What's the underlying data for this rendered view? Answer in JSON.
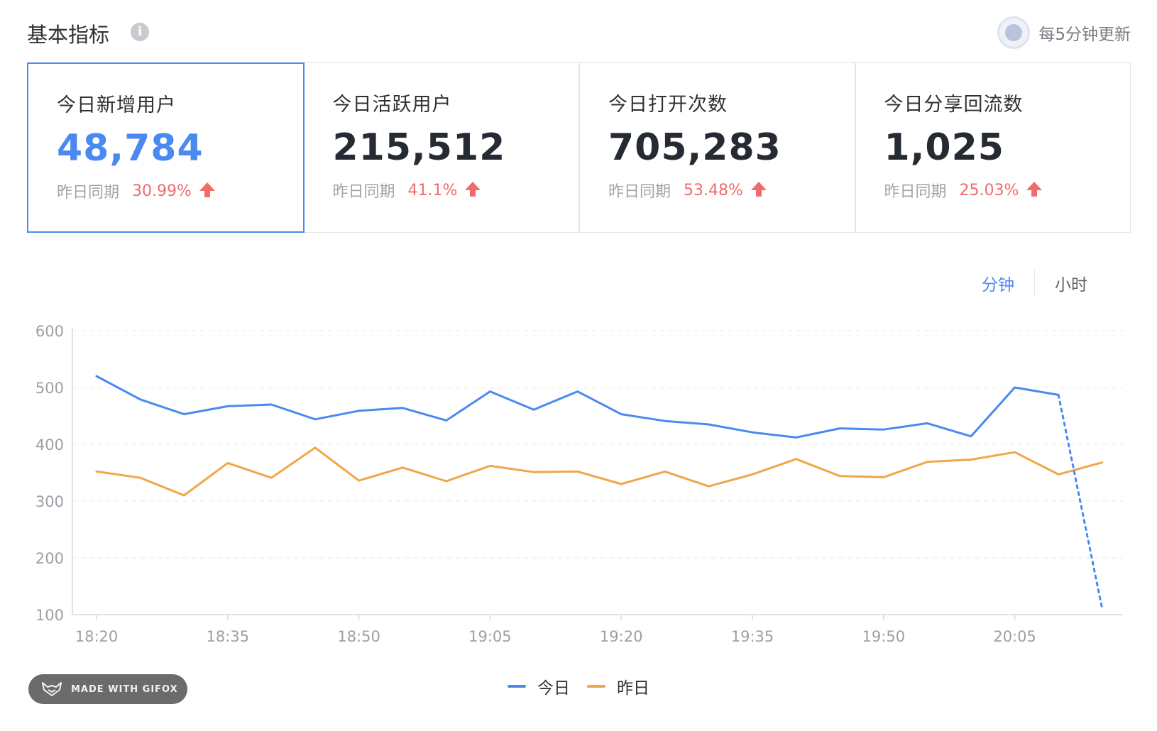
{
  "header": {
    "title": "基本指标",
    "info_icon": "info-icon",
    "refresh_text": "每5分钟更新",
    "refresh_icon": "refresh-globe-icon"
  },
  "cards": [
    {
      "title": "今日新增用户",
      "value": "48,784",
      "compare_label": "昨日同期",
      "compare_pct": "30.99%",
      "trend": "up",
      "active": true
    },
    {
      "title": "今日活跃用户",
      "value": "215,512",
      "compare_label": "昨日同期",
      "compare_pct": "41.1%",
      "trend": "up",
      "active": false
    },
    {
      "title": "今日打开次数",
      "value": "705,283",
      "compare_label": "昨日同期",
      "compare_pct": "53.48%",
      "trend": "up",
      "active": false
    },
    {
      "title": "今日分享回流数",
      "value": "1,025",
      "compare_label": "昨日同期",
      "compare_pct": "25.03%",
      "trend": "up",
      "active": false
    }
  ],
  "toggle": {
    "minute": "分钟",
    "hour": "小时",
    "selected": "minute"
  },
  "colors": {
    "accent": "#4a8af0",
    "today": "#4a8af0",
    "yesterday": "#f2a549",
    "up": "#ef6c6c"
  },
  "watermark": "MADE WITH GIFOX",
  "chart_data": {
    "type": "line",
    "x": [
      "18:20",
      "18:25",
      "18:30",
      "18:35",
      "18:40",
      "18:45",
      "18:50",
      "18:55",
      "19:00",
      "19:05",
      "19:10",
      "19:15",
      "19:20",
      "19:25",
      "19:30",
      "19:35",
      "19:40",
      "19:45",
      "19:50",
      "19:55",
      "20:00",
      "20:05",
      "20:10",
      "20:15"
    ],
    "x_tick_labels": [
      "18:20",
      "18:35",
      "18:50",
      "19:05",
      "19:20",
      "19:35",
      "19:50",
      "20:05"
    ],
    "y_tick_labels": [
      "600",
      "500",
      "400",
      "300",
      "200",
      "100"
    ],
    "ylim": [
      100,
      600
    ],
    "grid": true,
    "legend": "bottom-center",
    "series": [
      {
        "name": "今日",
        "values": [
          520,
          479,
          453,
          467,
          470,
          444,
          459,
          464,
          442,
          493,
          461,
          493,
          453,
          441,
          435,
          421,
          412,
          428,
          426,
          437,
          414,
          500,
          487,
          110
        ],
        "dashed_last_segment": true
      },
      {
        "name": "昨日",
        "values": [
          352,
          341,
          310,
          367,
          341,
          394,
          336,
          359,
          335,
          362,
          351,
          352,
          330,
          352,
          326,
          347,
          374,
          344,
          342,
          369,
          373,
          386,
          347,
          368
        ]
      }
    ]
  }
}
